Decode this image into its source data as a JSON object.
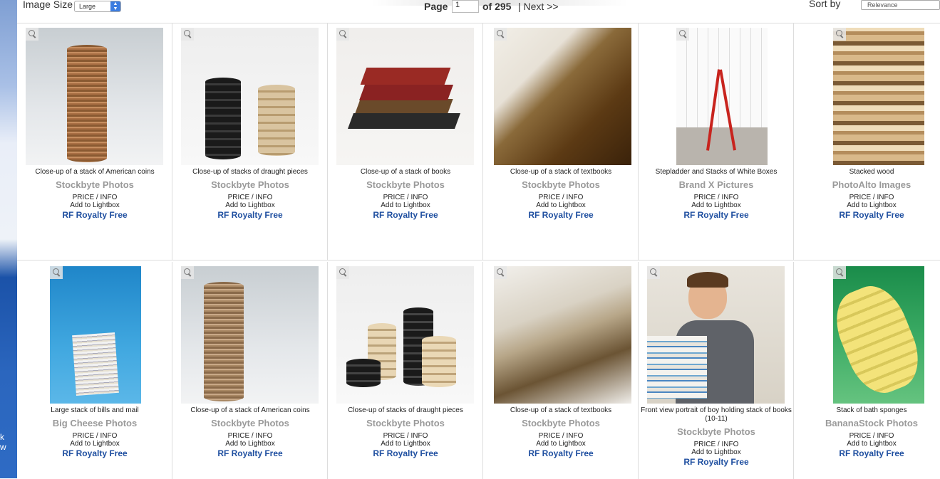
{
  "toolbar": {
    "image_size_label": "Image Size",
    "image_size_value": "Large",
    "page_label": "Page",
    "page_value": "1",
    "of_text": "of 295",
    "next_text": "| Next >>",
    "sort_label": "Sort by",
    "sort_value": "Relevance"
  },
  "left_fragments": [
    "k",
    "w"
  ],
  "results": [
    {
      "caption": "Close-up of a stack of American coins",
      "brand": "Stockbyte Photos",
      "price": "PRICE / INFO",
      "lightbox": "Add to Lightbox",
      "license": "RF Royalty Free",
      "icon": "coin-stack-image"
    },
    {
      "caption": "Close-up of stacks of draught pieces",
      "brand": "Stockbyte Photos",
      "price": "PRICE / INFO",
      "lightbox": "Add to Lightbox",
      "license": "RF Royalty Free",
      "icon": "draught-stacks-image"
    },
    {
      "caption": "Close-up of a stack of books",
      "brand": "Stockbyte Photos",
      "price": "PRICE / INFO",
      "lightbox": "Add to Lightbox",
      "license": "RF Royalty Free",
      "icon": "book-stack-image"
    },
    {
      "caption": "Close-up of a stack of textbooks",
      "brand": "Stockbyte Photos",
      "price": "PRICE / INFO",
      "lightbox": "Add to Lightbox",
      "license": "RF Royalty Free",
      "icon": "textbooks-image"
    },
    {
      "caption": "Stepladder and Stacks of White Boxes",
      "brand": "Brand X Pictures",
      "price": "PRICE / INFO",
      "lightbox": "Add to Lightbox",
      "license": "RF Royalty Free",
      "icon": "stepladder-image"
    },
    {
      "caption": "Stacked wood",
      "brand": "PhotoAlto Images",
      "price": "PRICE / INFO",
      "lightbox": "Add to Lightbox",
      "license": "RF Royalty Free",
      "icon": "stacked-wood-image"
    },
    {
      "caption": "Large stack of bills and mail",
      "brand": "Big Cheese Photos",
      "price": "PRICE / INFO",
      "lightbox": "Add to Lightbox",
      "license": "RF Royalty Free",
      "icon": "bills-mail-image"
    },
    {
      "caption": "Close-up of a stack of American coins",
      "brand": "Stockbyte Photos",
      "price": "PRICE / INFO",
      "lightbox": "Add to Lightbox",
      "license": "RF Royalty Free",
      "icon": "coin-stack-image"
    },
    {
      "caption": "Close-up of stacks of draught pieces",
      "brand": "Stockbyte Photos",
      "price": "PRICE / INFO",
      "lightbox": "Add to Lightbox",
      "license": "RF Royalty Free",
      "icon": "draught-stacks-image"
    },
    {
      "caption": "Close-up of a stack of textbooks",
      "brand": "Stockbyte Photos",
      "price": "PRICE / INFO",
      "lightbox": "Add to Lightbox",
      "license": "RF Royalty Free",
      "icon": "textbooks-image"
    },
    {
      "caption": "Front view portrait of boy holding stack of books (10-11)",
      "brand": "Stockbyte Photos",
      "price": "PRICE / INFO",
      "lightbox": "Add to Lightbox",
      "license": "RF Royalty Free",
      "icon": "boy-books-image"
    },
    {
      "caption": "Stack of bath sponges",
      "brand": "BananaStock Photos",
      "price": "PRICE / INFO",
      "lightbox": "Add to Lightbox",
      "license": "RF Royalty Free",
      "icon": "bath-sponges-image"
    }
  ]
}
